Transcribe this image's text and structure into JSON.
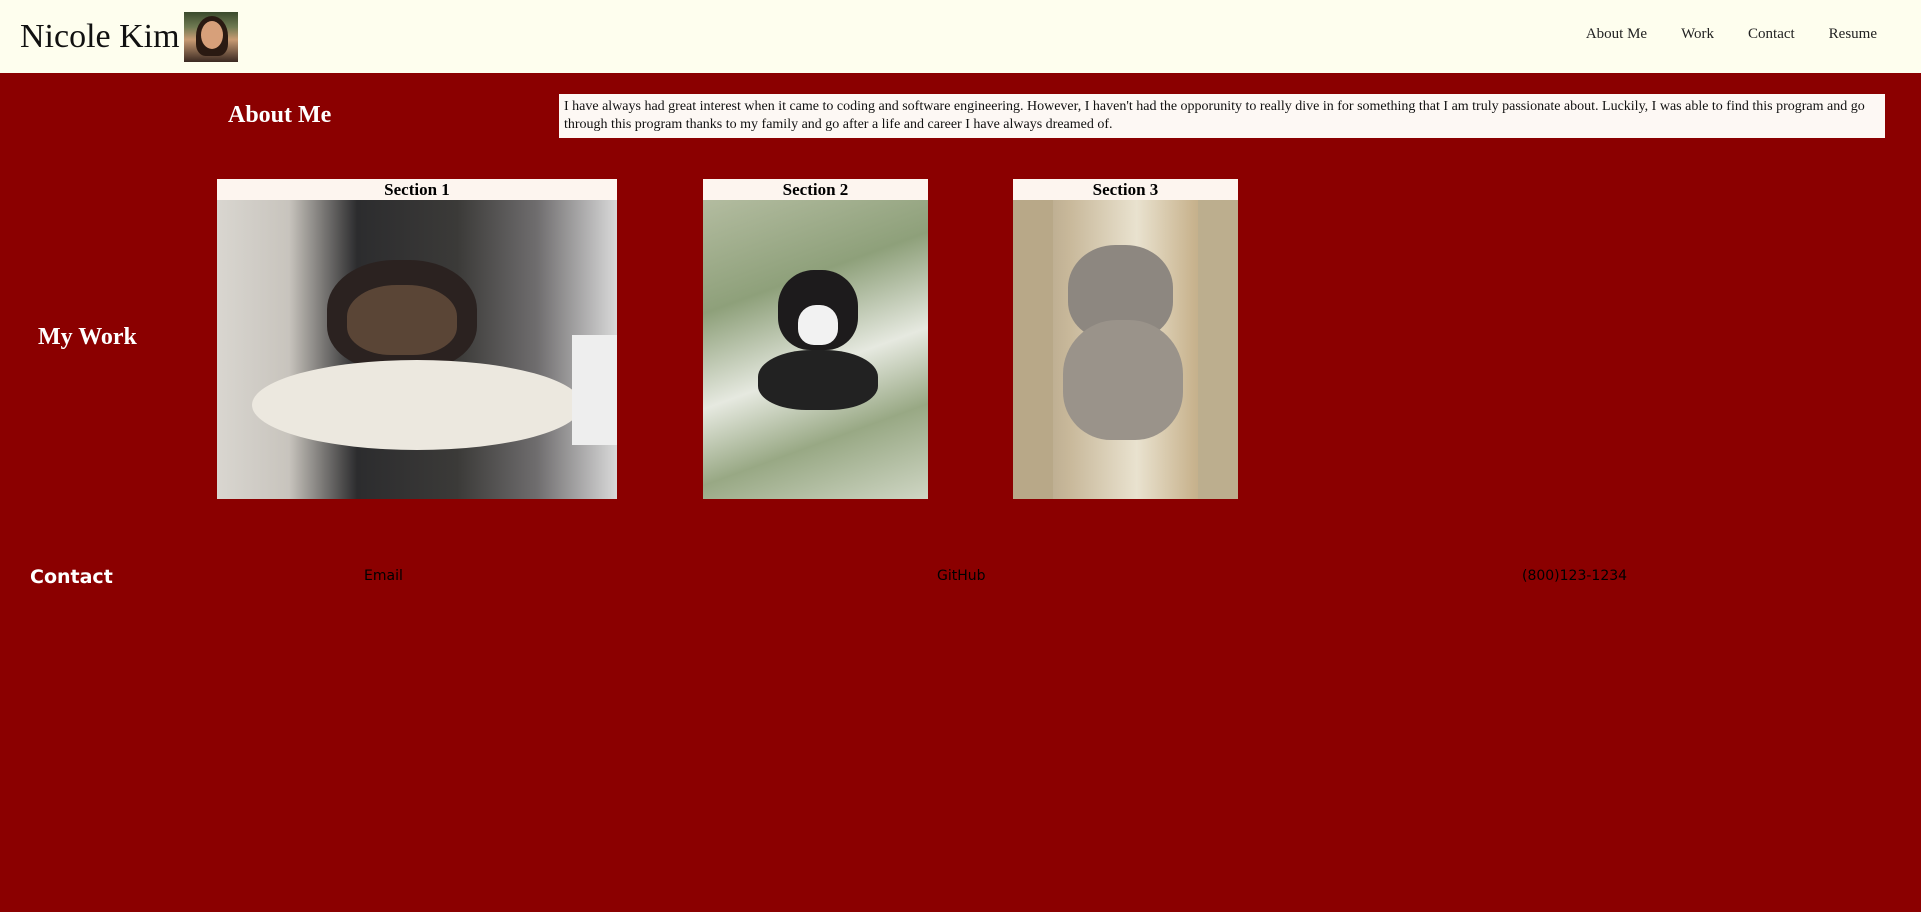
{
  "header": {
    "name": "Nicole Kim",
    "nav": [
      {
        "label": "About Me"
      },
      {
        "label": "Work"
      },
      {
        "label": "Contact"
      },
      {
        "label": "Resume"
      }
    ],
    "background_color": "#fefeee"
  },
  "about": {
    "heading": "About Me",
    "text": "I have always had great interest when it came to coding and software engineering. However, I haven't had the opporunity to really dive in for something that I am truly passionate about. Luckily, I was able to find this program and go through this program thanks to my family and go after a life and career I have always dreamed of."
  },
  "work": {
    "heading": "My Work",
    "sections": [
      {
        "title": "Section 1"
      },
      {
        "title": "Section 2"
      },
      {
        "title": "Section 3"
      }
    ]
  },
  "contact": {
    "heading": "Contact",
    "email_label": "Email",
    "github_label": "GitHub",
    "phone": "(800)123-1234"
  },
  "colors": {
    "page_background": "#8b0000",
    "header_background": "#fefeee",
    "text_light": "#ffffff"
  }
}
